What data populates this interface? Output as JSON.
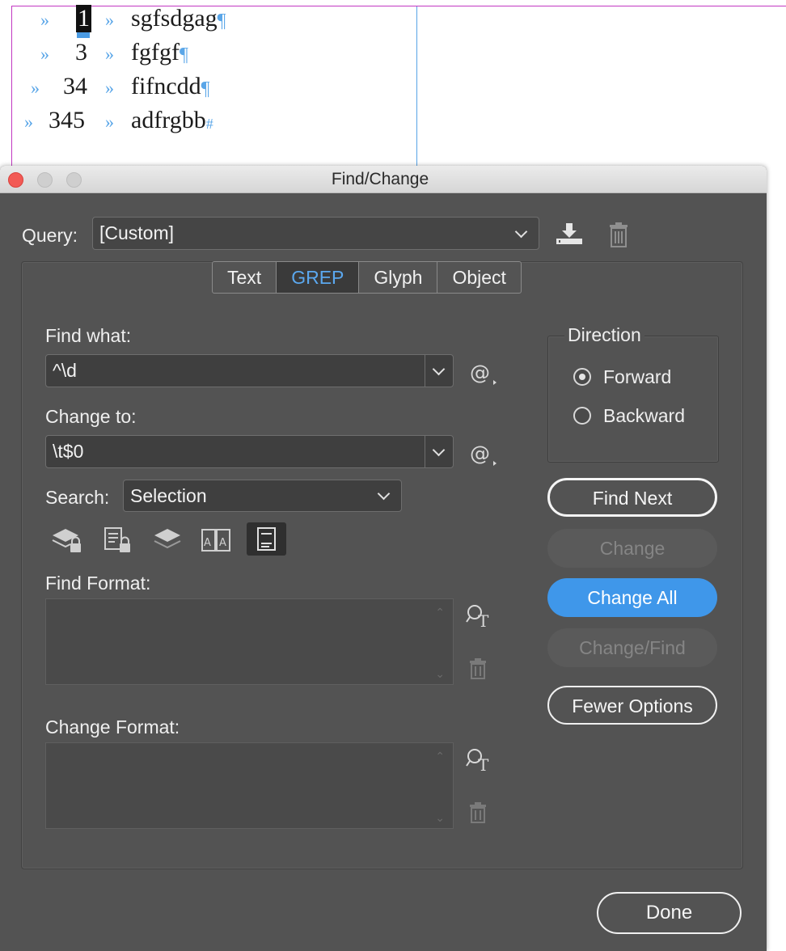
{
  "document": {
    "lines": [
      {
        "number": "1",
        "text": "sgfsdgag",
        "end_mark": "¶",
        "selected": true
      },
      {
        "number": "3",
        "text": "fgfgf",
        "end_mark": "¶"
      },
      {
        "number": "34",
        "text": "fifncdd",
        "end_mark": "¶"
      },
      {
        "number": "345",
        "text": "adfrgbb",
        "end_mark": "#"
      }
    ],
    "tab_marker": "»"
  },
  "dialog": {
    "title": "Find/Change",
    "query": {
      "label": "Query:",
      "value": "[Custom]"
    },
    "tabs": [
      {
        "label": "Text",
        "active": false
      },
      {
        "label": "GREP",
        "active": true
      },
      {
        "label": "Glyph",
        "active": false
      },
      {
        "label": "Object",
        "active": false
      }
    ],
    "find_what": {
      "label": "Find what:",
      "value": "^\\d"
    },
    "change_to": {
      "label": "Change to:",
      "value": "\\t$0"
    },
    "search": {
      "label": "Search:",
      "value": "Selection"
    },
    "find_format": {
      "label": "Find Format:"
    },
    "change_format": {
      "label": "Change Format:"
    },
    "direction": {
      "label": "Direction",
      "options": [
        {
          "label": "Forward",
          "selected": true
        },
        {
          "label": "Backward",
          "selected": false
        }
      ]
    },
    "buttons": {
      "find_next": "Find Next",
      "change": "Change",
      "change_all": "Change All",
      "change_find": "Change/Find",
      "fewer_options": "Fewer Options",
      "done": "Done"
    },
    "search_option_icons": [
      "include-locked-layers-icon",
      "include-locked-stories-icon",
      "include-hidden-layers-icon",
      "include-master-pages-icon",
      "include-footnotes-icon"
    ],
    "colors": {
      "accent": "#3f97ea",
      "active_tab_text": "#5ba8ef",
      "dialog_bg": "#535353",
      "pilcrow": "#5aa6e8"
    }
  }
}
